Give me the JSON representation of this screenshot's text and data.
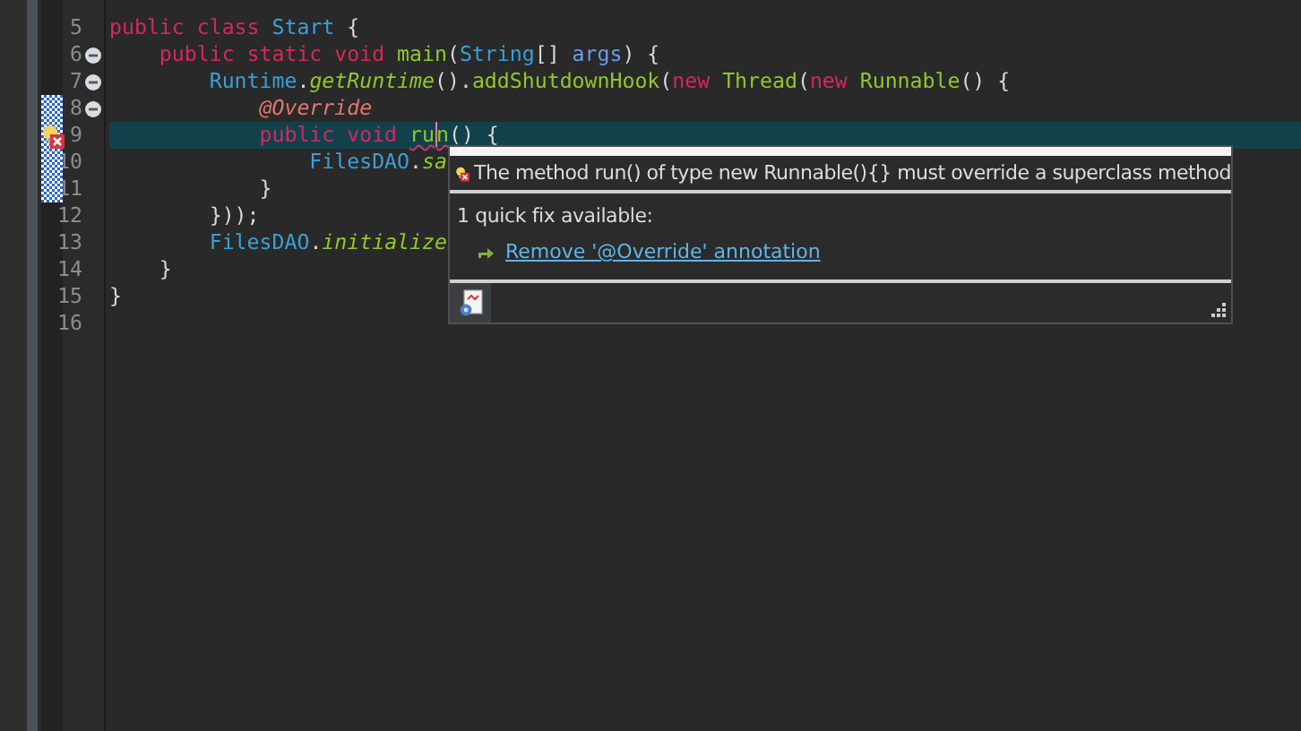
{
  "editor": {
    "lines": [
      {
        "number": "5",
        "fold": false,
        "current": false,
        "range": false,
        "has_error": false,
        "tokens": [
          {
            "kind": "keyword",
            "text": "public class "
          },
          {
            "kind": "type",
            "text": "Start"
          },
          {
            "kind": "plain",
            "text": " {"
          }
        ]
      },
      {
        "number": "6",
        "fold": true,
        "current": false,
        "range": false,
        "has_error": false,
        "tokens": [
          {
            "kind": "keyword",
            "text": "    public static void "
          },
          {
            "kind": "method",
            "text": "main"
          },
          {
            "kind": "plain",
            "text": "("
          },
          {
            "kind": "type",
            "text": "String"
          },
          {
            "kind": "plain",
            "text": "[] "
          },
          {
            "kind": "param",
            "text": "args"
          },
          {
            "kind": "plain",
            "text": ") {"
          }
        ]
      },
      {
        "number": "7",
        "fold": true,
        "current": false,
        "range": false,
        "has_error": false,
        "tokens": [
          {
            "kind": "type",
            "text": "        Runtime"
          },
          {
            "kind": "plain",
            "text": "."
          },
          {
            "kind": "static",
            "text": "getRuntime"
          },
          {
            "kind": "plain",
            "text": "()."
          },
          {
            "kind": "method",
            "text": "addShutdownHook"
          },
          {
            "kind": "plain",
            "text": "("
          },
          {
            "kind": "keyword",
            "text": "new "
          },
          {
            "kind": "method",
            "text": "Thread"
          },
          {
            "kind": "plain",
            "text": "("
          },
          {
            "kind": "keyword",
            "text": "new "
          },
          {
            "kind": "method",
            "text": "Runnable"
          },
          {
            "kind": "plain",
            "text": "() {"
          }
        ]
      },
      {
        "number": "8",
        "fold": true,
        "current": false,
        "range": true,
        "has_error": false,
        "tokens": [
          {
            "kind": "annotation",
            "text": "            @Override"
          }
        ]
      },
      {
        "number": "9",
        "fold": false,
        "current": true,
        "range": true,
        "has_error": true,
        "tokens": [
          {
            "kind": "keyword",
            "text": "            public void "
          },
          {
            "kind": "method",
            "text": "ru",
            "error": true,
            "caret": true
          },
          {
            "kind": "method",
            "text": "n",
            "error": true,
            "caret": false
          },
          {
            "kind": "plain",
            "text": "() {"
          }
        ]
      },
      {
        "number": "10",
        "fold": false,
        "current": false,
        "range": true,
        "has_error": false,
        "tokens": [
          {
            "kind": "type",
            "text": "                FilesDAO"
          },
          {
            "kind": "plain",
            "text": "."
          },
          {
            "kind": "static",
            "text": "sa"
          }
        ]
      },
      {
        "number": "11",
        "fold": false,
        "current": false,
        "range": true,
        "has_error": false,
        "tokens": [
          {
            "kind": "plain",
            "text": "            }"
          }
        ]
      },
      {
        "number": "12",
        "fold": false,
        "current": false,
        "range": false,
        "has_error": false,
        "tokens": [
          {
            "kind": "plain",
            "text": "        }));"
          }
        ]
      },
      {
        "number": "13",
        "fold": false,
        "current": false,
        "range": false,
        "has_error": false,
        "tokens": [
          {
            "kind": "type",
            "text": "        FilesDAO"
          },
          {
            "kind": "plain",
            "text": "."
          },
          {
            "kind": "static",
            "text": "initialize"
          }
        ]
      },
      {
        "number": "14",
        "fold": false,
        "current": false,
        "range": false,
        "has_error": false,
        "tokens": [
          {
            "kind": "plain",
            "text": "    }"
          }
        ]
      },
      {
        "number": "15",
        "fold": false,
        "current": false,
        "range": false,
        "has_error": false,
        "tokens": [
          {
            "kind": "plain",
            "text": "}"
          }
        ]
      },
      {
        "number": "16",
        "fold": false,
        "current": false,
        "range": false,
        "has_error": false
      }
    ]
  },
  "quick_fix_popup": {
    "message": "The method run() of type new Runnable(){} must override a superclass method",
    "summary": "1 quick fix available:",
    "fixes": [
      {
        "label": "Remove '@Override' annotation"
      }
    ]
  }
}
